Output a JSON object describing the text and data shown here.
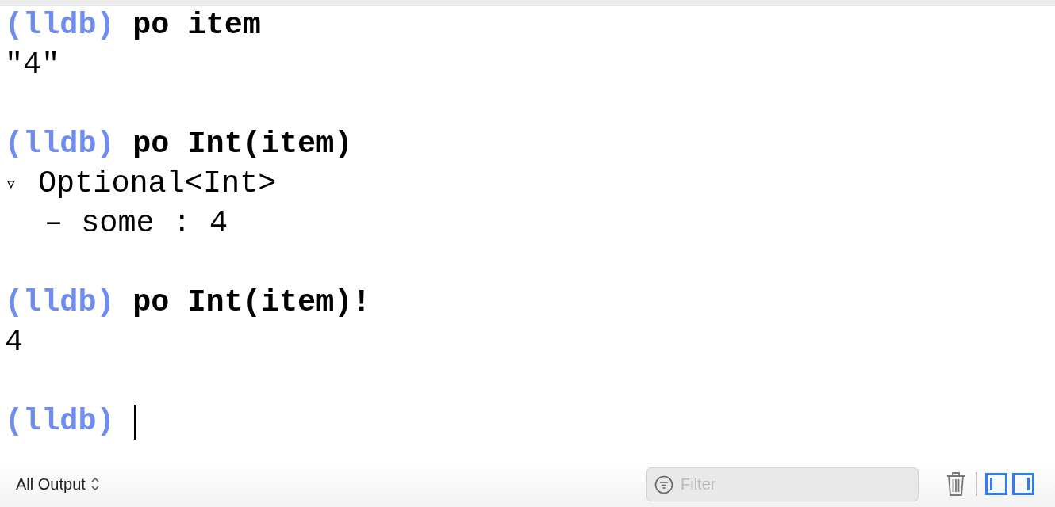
{
  "console": {
    "lines": [
      {
        "kind": "prompt",
        "prompt": "(lldb)",
        "command": "po item"
      },
      {
        "kind": "output",
        "text": "\"4\""
      },
      {
        "kind": "blank"
      },
      {
        "kind": "prompt",
        "prompt": "(lldb)",
        "command": "po Int(item)"
      },
      {
        "kind": "tree",
        "toggle": "▿",
        "expanded": true,
        "label": "Optional<Int>",
        "children": [
          {
            "text": "– some : 4"
          }
        ]
      },
      {
        "kind": "blank"
      },
      {
        "kind": "prompt",
        "prompt": "(lldb)",
        "command": "po Int(item)!"
      },
      {
        "kind": "output",
        "text": "4"
      },
      {
        "kind": "blank"
      },
      {
        "kind": "prompt",
        "prompt": "(lldb)",
        "cursor": true
      }
    ]
  },
  "status_bar": {
    "scope": "All Output",
    "filter": {
      "placeholder": "Filter"
    },
    "panel_toggles": [
      {
        "selected": true
      },
      {
        "selected": true
      }
    ]
  }
}
